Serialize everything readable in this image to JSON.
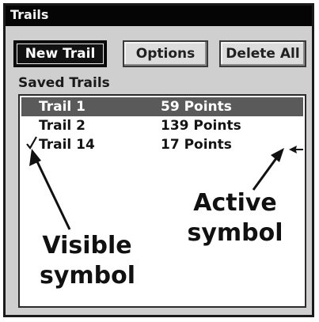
{
  "window": {
    "title": "Trails"
  },
  "toolbar": {
    "new_trail_label": "New Trail",
    "options_label": "Options",
    "delete_all_label": "Delete All"
  },
  "saved_trails": {
    "label": "Saved Trails",
    "rows": [
      {
        "name": "Trail 1",
        "points": "59 Points",
        "selected": true,
        "visible": false,
        "active": false
      },
      {
        "name": "Trail 2",
        "points": "139 Points",
        "selected": false,
        "visible": false,
        "active": false
      },
      {
        "name": "Trail 14",
        "points": "17 Points",
        "selected": false,
        "visible": true,
        "active": true
      }
    ]
  },
  "annotations": {
    "visible_symbol": "Visible symbol",
    "active_symbol": "Active symbol"
  },
  "icons": {
    "visible": "checkmark-icon",
    "active": "active-trail-icon"
  },
  "colors": {
    "title_bar": "#050505",
    "panel": "#cfcfcf",
    "selection": "#5a5a5a"
  }
}
